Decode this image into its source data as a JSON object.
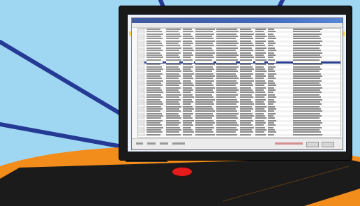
{
  "scene": {
    "background_color": "#9fd6f2",
    "ray_color": "#253a95",
    "orange_color": "#f28c1b",
    "dark_color": "#1b1b1b"
  },
  "monitor": {
    "bezel_color": "#1a1a1a",
    "power_light_color": "#e61b1b"
  },
  "spreadsheet": {
    "selected_row_color": "#2a3f8e",
    "title_bar_color": "#1b3a8c",
    "row_count": 46,
    "selected_row_index": 14
  }
}
